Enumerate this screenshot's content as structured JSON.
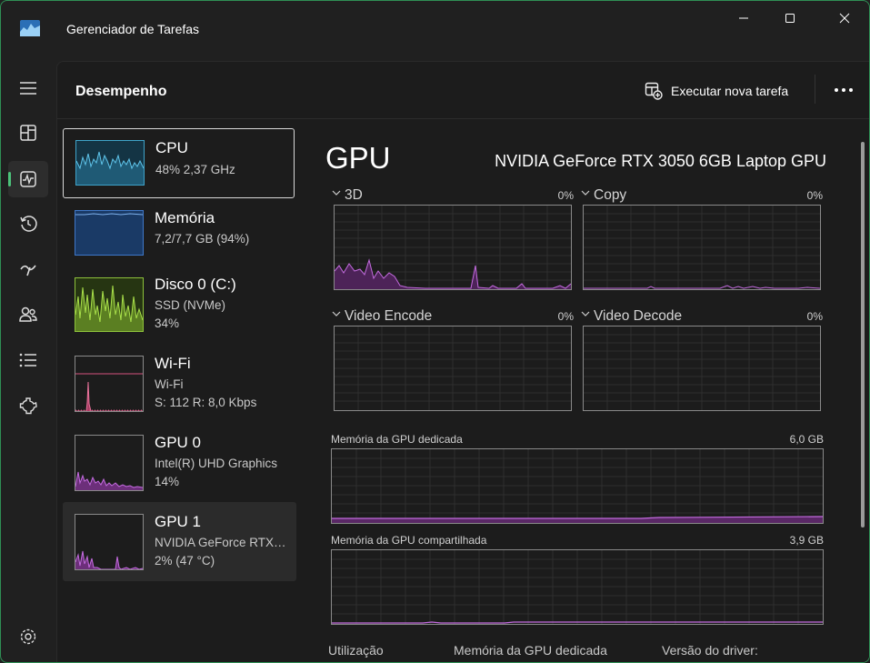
{
  "window": {
    "title": "Gerenciador de Tarefas"
  },
  "header": {
    "title": "Desempenho",
    "run_task_label": "Executar nova tarefa"
  },
  "nav": {
    "items": [
      "menu-icon",
      "processes-icon",
      "performance-icon",
      "app-history-icon",
      "startup-apps-icon",
      "users-icon",
      "details-icon",
      "services-icon",
      "settings-icon"
    ],
    "active": "performance"
  },
  "devices": [
    {
      "name": "CPU",
      "line1": "48%  2,37 GHz",
      "line2": "",
      "color": "#3fa3c9"
    },
    {
      "name": "Memória",
      "line1": "7,2/7,7 GB (94%)",
      "line2": "",
      "color": "#3f78c9"
    },
    {
      "name": "Disco 0 (C:)",
      "line1": "SSD (NVMe)",
      "line2": "34%",
      "color": "#8ec23b"
    },
    {
      "name": "Wi-Fi",
      "line1": "Wi-Fi",
      "line2": "S: 112  R: 8,0 Kbps",
      "color": "#d3527e"
    },
    {
      "name": "GPU 0",
      "line1": "Intel(R) UHD Graphics",
      "line2": "14%",
      "color": "#b152c9"
    },
    {
      "name": "GPU 1",
      "line1": "NVIDIA GeForce RTX…",
      "line2": "2%  (47 °C)",
      "color": "#b152c9"
    }
  ],
  "detail": {
    "title": "GPU",
    "model": "NVIDIA GeForce RTX 3050 6GB Laptop GPU",
    "engines": [
      {
        "name": "3D",
        "pct": "0%"
      },
      {
        "name": "Copy",
        "pct": "0%"
      },
      {
        "name": "Video Encode",
        "pct": "0%"
      },
      {
        "name": "Video Decode",
        "pct": "0%"
      }
    ],
    "dedicated": {
      "label": "Memória da GPU dedicada",
      "max": "6,0 GB"
    },
    "shared": {
      "label": "Memória da GPU compartilhada",
      "max": "3,9 GB"
    },
    "bottom": {
      "utilization": "Utilização",
      "dedicated": "Memória da GPU dedicada",
      "driver": "Versão do driver:"
    }
  },
  "colors": {
    "accent": "#4cc27a",
    "gpu": "#b152c9",
    "grid": "#2e2e2e"
  }
}
